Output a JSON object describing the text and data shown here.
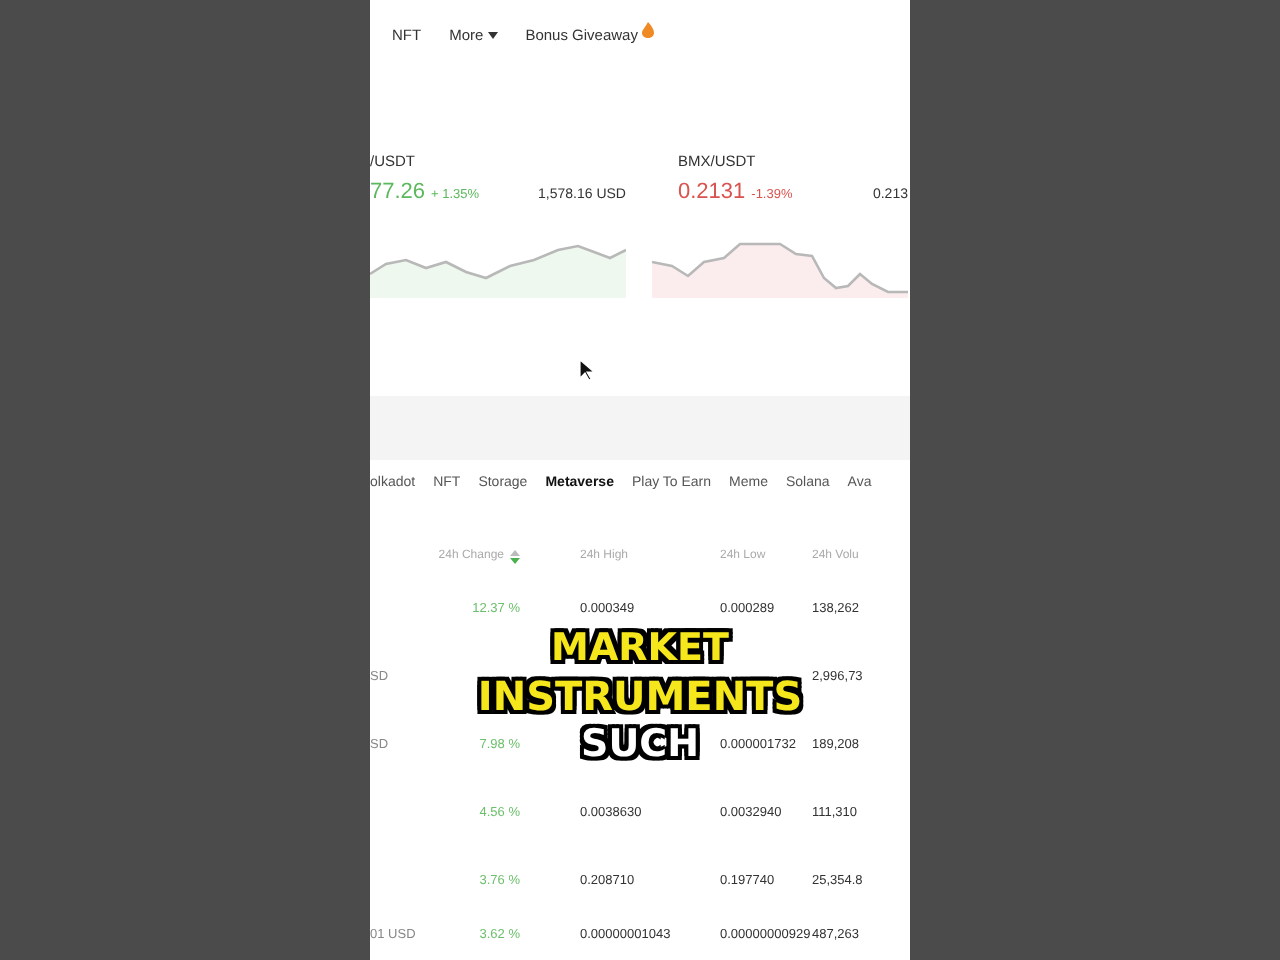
{
  "nav": [
    {
      "label": "NFT",
      "kind": "link"
    },
    {
      "label": "More",
      "kind": "dropdown"
    },
    {
      "label": "Bonus Giveaway",
      "kind": "promo"
    }
  ],
  "cards": [
    {
      "pair": "/USDT",
      "price": "77.26",
      "change": "+ 1.35%",
      "color": "#5cb85c",
      "usd": "1,578.16 USD"
    },
    {
      "pair": "BMX/USDT",
      "price": "0.2131",
      "change": "-1.39%",
      "color": "#d9534f",
      "usd": "0.213"
    }
  ],
  "tabs": [
    {
      "label": "olkadot",
      "selected": false
    },
    {
      "label": "NFT",
      "selected": false
    },
    {
      "label": "Storage",
      "selected": false
    },
    {
      "label": "Metaverse",
      "selected": true
    },
    {
      "label": "Play To Earn",
      "selected": false
    },
    {
      "label": "Meme",
      "selected": false
    },
    {
      "label": "Solana",
      "selected": false
    },
    {
      "label": "Ava",
      "selected": false
    }
  ],
  "table": {
    "columns": [
      {
        "label": "24h Change",
        "sortable": true
      },
      {
        "label": "24h High",
        "sortable": false
      },
      {
        "label": "24h Low",
        "sortable": false
      },
      {
        "label": "24h Volu",
        "sortable": false
      }
    ],
    "rows": [
      {
        "pair": "",
        "change": "12.37 %",
        "high": "0.000349",
        "low": "0.000289",
        "volume": "138,262"
      },
      {
        "pair": "SD",
        "change": "",
        "high": "",
        "low": "",
        "volume": "2,996,73"
      },
      {
        "pair": "SD",
        "change": "7.98 %",
        "high": "",
        "low": "0.000001732",
        "volume": "189,208"
      },
      {
        "pair": "",
        "change": "4.56 %",
        "high": "0.0038630",
        "low": "0.0032940",
        "volume": "111,310"
      },
      {
        "pair": "",
        "change": "3.76 %",
        "high": "0.208710",
        "low": "0.197740",
        "volume": "25,354.8"
      },
      {
        "pair": "01 USD",
        "change": "3.62 %",
        "high": "0.00000001043",
        "low": "0.00000000929",
        "volume": "487,263"
      }
    ]
  },
  "caption": [
    "MARKET",
    "INSTRUMENTS",
    "SUCH"
  ]
}
